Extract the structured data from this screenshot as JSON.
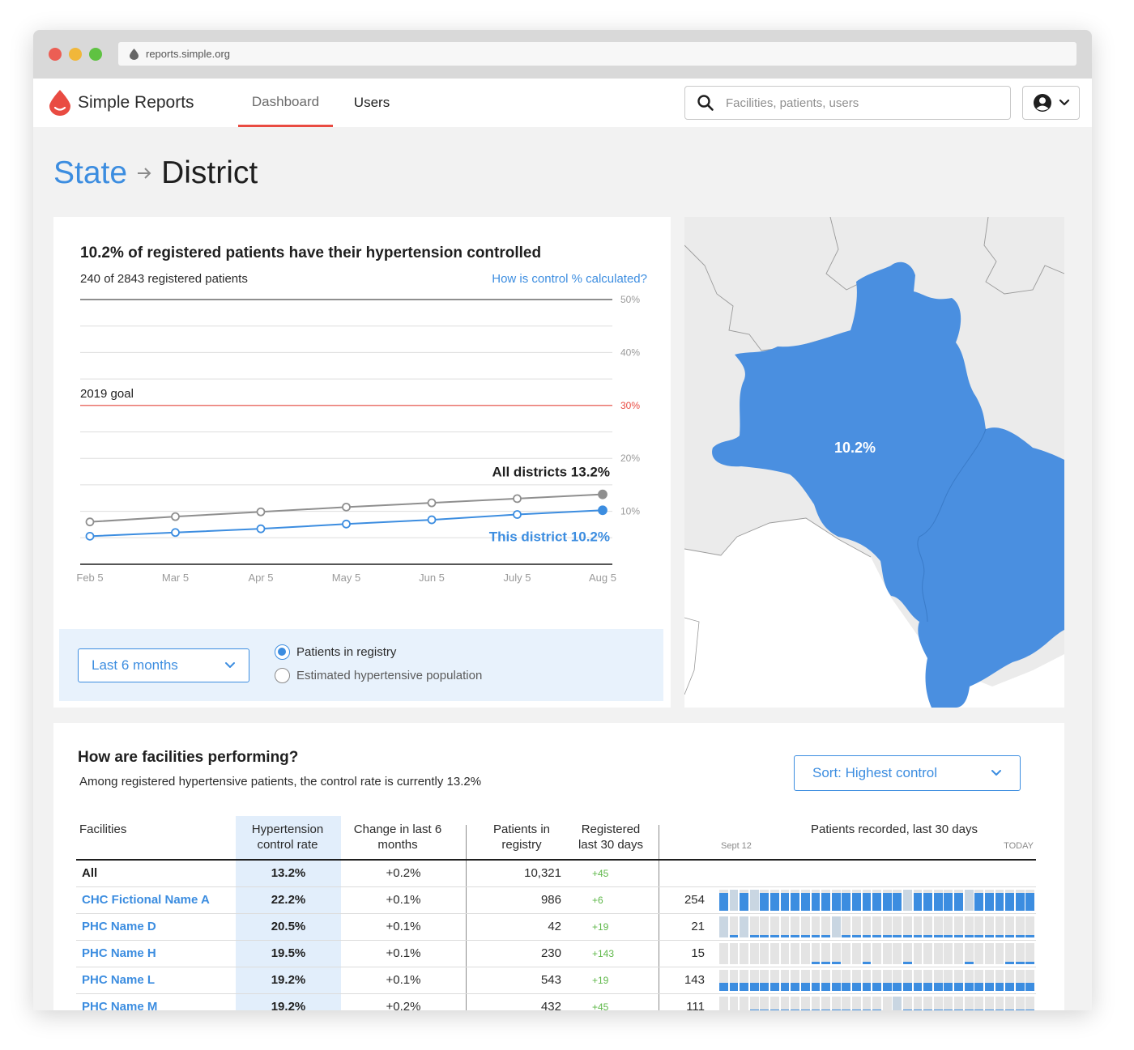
{
  "browser": {
    "url": "reports.simple.org"
  },
  "app": {
    "name": "Simple Reports",
    "tabs": [
      {
        "label": "Dashboard",
        "active": true
      },
      {
        "label": "Users",
        "active": false
      }
    ],
    "search_placeholder": "Facilities, patients, users",
    "accent_color": "#3c8de0",
    "brand_color": "#e94b42"
  },
  "breadcrumb": {
    "parent": "State",
    "current": "District"
  },
  "control": {
    "title": "10.2% of registered patients have their hypertension controlled",
    "subtitle": "240 of 2843 registered patients",
    "link": "How is control % calculated?",
    "period_select": "Last 6 months",
    "radios": [
      {
        "label": "Patients in registry",
        "checked": true
      },
      {
        "label": "Estimated hypertensive population",
        "checked": false
      }
    ]
  },
  "chart_data": {
    "type": "line",
    "categories": [
      "Feb 5",
      "Mar 5",
      "Apr 5",
      "May 5",
      "Jun 5",
      "July 5",
      "Aug 5"
    ],
    "ylim": [
      0,
      50
    ],
    "yticks": [
      "50%",
      "40%",
      "30%",
      "20%",
      "10%"
    ],
    "ytick_values": [
      50,
      40,
      30,
      20,
      10
    ],
    "goal": {
      "label": "2019 goal",
      "value": 30,
      "color": "#e94b42"
    },
    "series": [
      {
        "name": "All districts 13.2%",
        "values": [
          8.0,
          9.0,
          9.9,
          10.8,
          11.6,
          12.4,
          13.2
        ],
        "color": "#8f8f8f"
      },
      {
        "name": "This district 10.2%",
        "values": [
          5.3,
          6.0,
          6.7,
          7.6,
          8.4,
          9.4,
          10.2
        ],
        "color": "#3c8de0"
      }
    ]
  },
  "map": {
    "label": "10.2%",
    "district_color": "#4a8fe0"
  },
  "facilities": {
    "title": "How are facilities performing?",
    "subtitle": "Among registered hypertensive patients, the control rate is currently 13.2%",
    "sort_label": "Sort: Highest control",
    "columns": {
      "facility": "Facilities",
      "rate": "Hypertension control rate",
      "change": "Change in last 6 months",
      "registry": "Patients in registry",
      "registered": "Registered last 30 days",
      "recorded": "Patients recorded, last 30 days",
      "recorded_start": "Sept 12",
      "recorded_end": "TODAY"
    },
    "rows": [
      {
        "name": "All",
        "rate": "13.2%",
        "change": "+0.2%",
        "registry": "10,321",
        "new": "+45",
        "recorded": "",
        "pattern": ""
      },
      {
        "name": "CHC Fictional Name A",
        "rate": "22.2%",
        "change": "+0.1%",
        "registry": "986",
        "new": "+6",
        "recorded": "254",
        "pattern": "HSHSHHHHHHHHHHHHHHSHHHHHSHHHHHH"
      },
      {
        "name": "PHC Name D",
        "rate": "20.5%",
        "change": "+0.1%",
        "registry": "42",
        "new": "+19",
        "recorded": "21",
        "pattern": "SLSLLLLLLLLSLLLLLLLLLLLLLLLLLLL"
      },
      {
        "name": "PHC Name H",
        "rate": "19.5%",
        "change": "+0.1%",
        "registry": "230",
        "new": "+143",
        "recorded": "15",
        "pattern": "EEEEEEEEELLLEELEEELEEEEELEEELLL"
      },
      {
        "name": "PHC Name L",
        "rate": "19.2%",
        "change": "+0.1%",
        "registry": "543",
        "new": "+19",
        "recorded": "143",
        "pattern": "MMMMMMMMMMMMMMMMMMMMMMMMMMMMMMM"
      },
      {
        "name": "PHC Name M",
        "rate": "19.2%",
        "change": "+0.2%",
        "registry": "432",
        "new": "+45",
        "recorded": "111",
        "pattern": "LELMMMMMMMMMMMMMESMMMMMMMMMMMMM"
      }
    ]
  }
}
